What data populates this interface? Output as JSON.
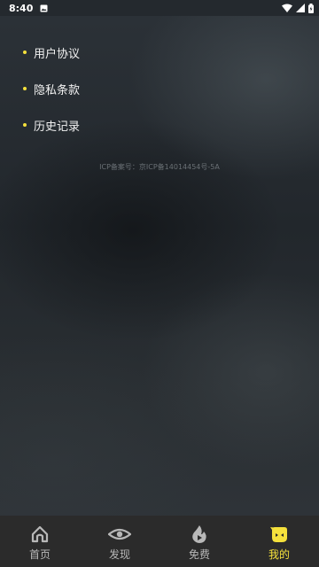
{
  "status_bar": {
    "time": "8:40"
  },
  "menu": {
    "items": [
      {
        "label": "用户协议"
      },
      {
        "label": "隐私条款"
      },
      {
        "label": "历史记录"
      }
    ]
  },
  "footer": {
    "icp": "ICP备案号：京ICP备14014454号-5A"
  },
  "tabbar": {
    "tabs": [
      {
        "label": "首页",
        "icon": "home-icon"
      },
      {
        "label": "发现",
        "icon": "eye-icon"
      },
      {
        "label": "免费",
        "icon": "flame-play-icon"
      },
      {
        "label": "我的",
        "icon": "profile-face-icon",
        "active": true
      }
    ]
  },
  "colors": {
    "accent": "#f5e13c",
    "tabbar_bg": "#2b2b2b",
    "inactive": "#b8b8b8"
  }
}
